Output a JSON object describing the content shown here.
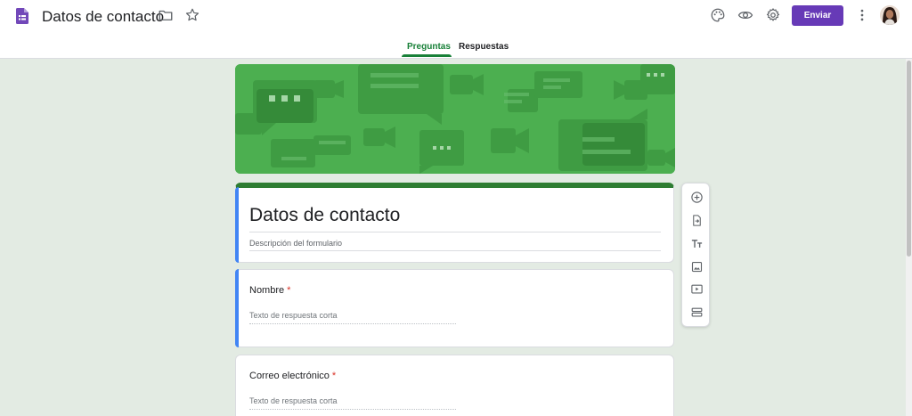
{
  "header": {
    "doc_title": "Datos de contacto",
    "send_label": "Enviar"
  },
  "tabs": {
    "questions": "Preguntas",
    "responses": "Respuestas"
  },
  "form": {
    "title": "Datos de contacto",
    "description_placeholder": "Descripción del formulario"
  },
  "questions": [
    {
      "title": "Nombre",
      "required_mark": "*",
      "answer_placeholder": "Texto de respuesta corta"
    },
    {
      "title": "Correo electrónico",
      "required_mark": "*",
      "answer_placeholder": "Texto de respuesta corta"
    }
  ],
  "icons": {
    "doc": "forms-doc-icon",
    "folder": "folder-icon",
    "star": "star-icon",
    "palette": "palette-icon",
    "preview": "eye-icon",
    "settings": "gear-icon",
    "more": "more-vert-icon",
    "add_question": "add-circle-icon",
    "import": "import-icon",
    "title_text": "text-title-icon",
    "image": "image-icon",
    "video": "video-icon",
    "section": "section-icon"
  },
  "colors": {
    "accent_purple": "#673ab7",
    "theme_green": "#188038",
    "banner_green": "#4caf50",
    "background": "#e3ebe3",
    "required_red": "#d93025",
    "active_bar_blue": "#4285f4"
  }
}
